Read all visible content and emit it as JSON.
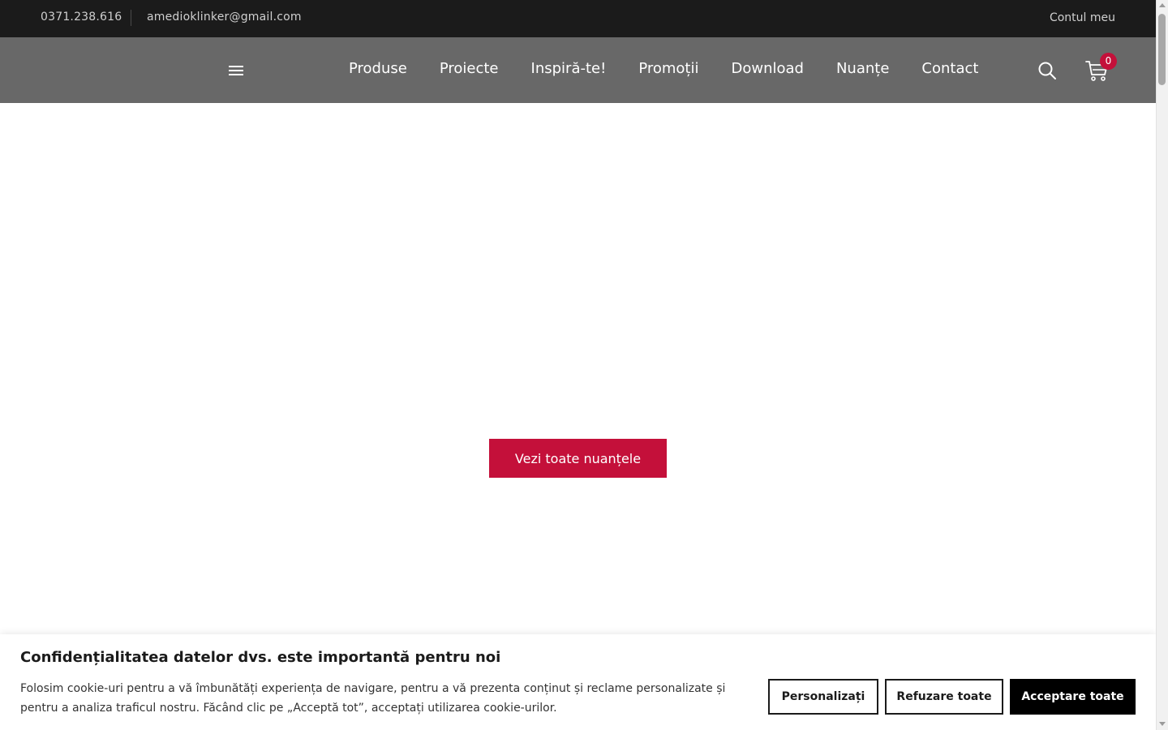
{
  "topbar": {
    "phone": "0371.238.616",
    "email": "amedioklinker@gmail.com",
    "account": "Contul meu"
  },
  "nav": {
    "items": [
      {
        "label": "Produse"
      },
      {
        "label": "Proiecte"
      },
      {
        "label": "Inspiră-te!"
      },
      {
        "label": "Promoții"
      },
      {
        "label": "Download"
      },
      {
        "label": "Nuanțe"
      },
      {
        "label": "Contact"
      }
    ],
    "cart_count": "0"
  },
  "main": {
    "cta_label": "Vezi toate nuanțele"
  },
  "cookie": {
    "title": "Confidențialitatea datelor dvs. este importantă pentru noi",
    "text": "Folosim cookie-uri pentru a vă îmbunătăți experiența de navigare, pentru a vă prezenta conținut și reclame personalizate și pentru a analiza traficul nostru. Făcând clic pe „Acceptă tot”, acceptați utilizarea cookie-urilor.",
    "customize_label": "Personalizați",
    "reject_label": "Refuzare toate",
    "accept_label": "Acceptare toate"
  },
  "colors": {
    "topbar_bg": "#1b1b1b",
    "navbar_bg": "#686868",
    "accent": "#c4103a",
    "accept_bg": "#000000"
  },
  "icons": {
    "menu": "hamburger-icon",
    "search": "search-icon",
    "cart": "cart-icon"
  }
}
